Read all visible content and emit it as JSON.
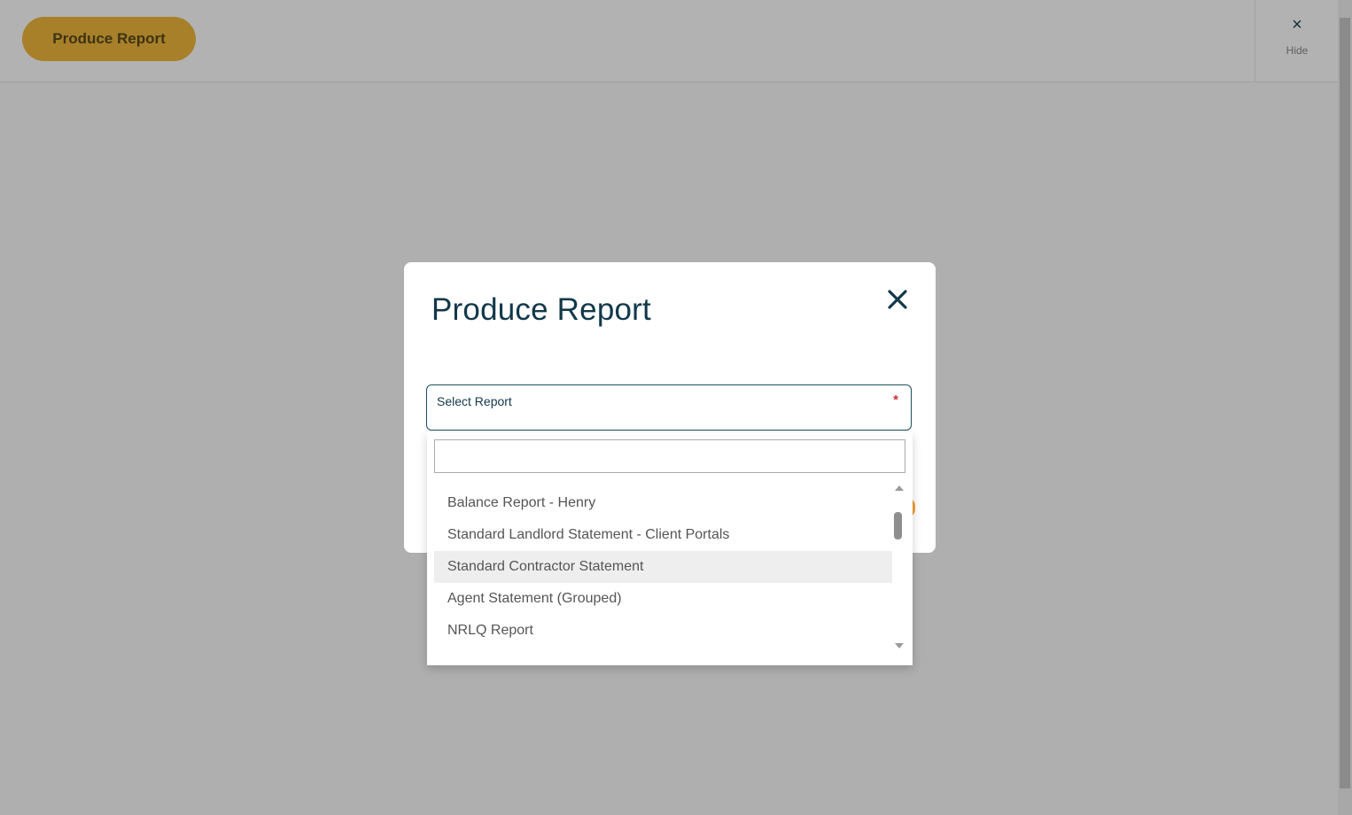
{
  "toolbar": {
    "produce_report_label": "Produce Report",
    "hide_label": "Hide"
  },
  "modal": {
    "title": "Produce Report",
    "select_label": "Select Report",
    "required_marker": "*",
    "search_value": "",
    "options": [
      "Balance Report - Henry",
      "Standard Landlord Statement - Client Portals",
      "Standard Contractor Statement",
      "Agent Statement (Grouped)",
      "NRLQ Report"
    ],
    "highlighted_option": "Standard Contractor Statement"
  },
  "colors": {
    "accent": "#f0b83c",
    "primary_text": "#12384a",
    "required": "#d0303a",
    "highlight_bg": "#eeeeee"
  },
  "icons": {
    "close": "close-icon",
    "scroll_up": "chevron-up-icon",
    "scroll_down": "chevron-down-icon"
  }
}
